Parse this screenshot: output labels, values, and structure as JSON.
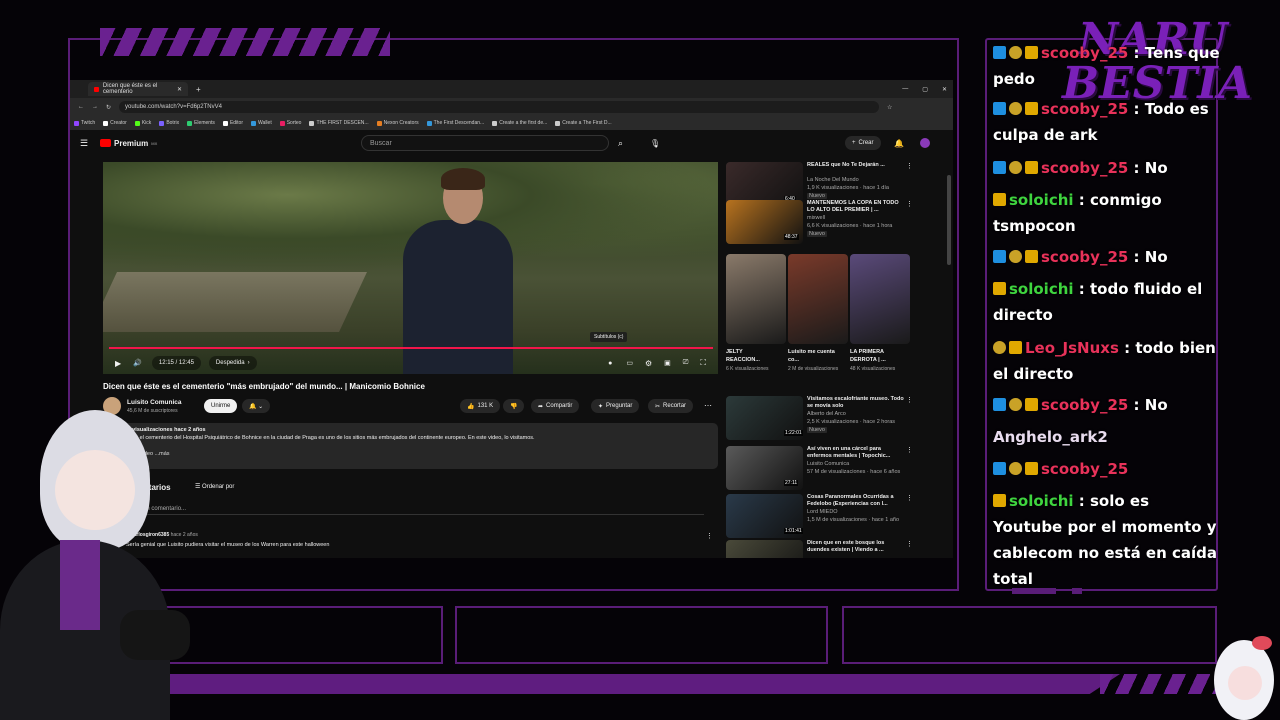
{
  "browser": {
    "tab_title": "Dicen que éste es el cementerio",
    "url": "youtube.com/watch?v=Fd6p2TNvV4",
    "bookmarks": [
      {
        "label": "Twitch",
        "color": "#9146ff"
      },
      {
        "label": "Creator",
        "color": "#ffffff"
      },
      {
        "label": "Kick",
        "color": "#53fc18"
      },
      {
        "label": "Botrix",
        "color": "#7b61ff"
      },
      {
        "label": "Elements",
        "color": "#2ecc71"
      },
      {
        "label": "Editor",
        "color": "#ffffff"
      },
      {
        "label": "Wallet",
        "color": "#3498db"
      },
      {
        "label": "Sorteo",
        "color": "#e91e63"
      },
      {
        "label": "THE FIRST DESCEN...",
        "color": "#cccccc"
      },
      {
        "label": "Nexon Creators",
        "color": "#e67e22"
      },
      {
        "label": "The First Descendan...",
        "color": "#3498db"
      },
      {
        "label": "Create a the first de...",
        "color": "#cccccc"
      },
      {
        "label": "Create a The First D...",
        "color": "#cccccc"
      }
    ]
  },
  "youtube": {
    "brand": "Premium",
    "brand_sup": "MX",
    "search_placeholder": "Buscar",
    "create_label": "Crear",
    "time": "12:15 / 12:45",
    "chapter": "Despedida",
    "tooltip": "Subtítulos (c)",
    "video_title": "Dicen que éste es el cementerio \"más embrujado\" del mundo... | Manicomio Bohnice",
    "channel": "Luisito Comunica",
    "subscribers": "45,6 M de suscriptores",
    "join_label": "Unirme",
    "likes": "131 K",
    "share_label": "Compartir",
    "ask_label": "Preguntar",
    "clip_label": "Recortar",
    "views_line": "7,2 M de visualizaciones  hace 2 años",
    "description": "Se dice que el cementerio del Hospital Psiquiátrico de Bohnice en la ciudad de Praga es uno de los sitios más embrujados del continente europeo. En este video, lo visitamos.",
    "desc_more": "Partes en el video  ...más",
    "comments_count": "2576 comentarios",
    "sort_label": "Ordenar por",
    "add_comment": "Añade un comentario...",
    "comment_user": "@carlosgiron6385",
    "comment_time": "hace 2 años",
    "comment_text": "Sería genial que Luisito pudiera visitar el museo de los Warren para este halloween"
  },
  "recommendations": [
    {
      "title": "REALES que No Te Dejarán ...",
      "channel": "La Noche Del Mundo",
      "stats": "1,9 K visualizaciones · hace 1 día",
      "badge": "Nuevo",
      "duration": "6:40",
      "color": "#3a2a2a"
    },
    {
      "title": "MANTENEMOS LA COPA EN TODO LO ALTO DEL PREMIER | ...",
      "channel": "mixwell",
      "stats": "6,6 K visualizaciones · hace 1 hora",
      "badge": "Nuevo",
      "duration": "48:37",
      "color": "#b8731f"
    },
    {
      "title": "Visitamos escalofriante museo. Todo se movía solo",
      "channel": "Alberto del Arco",
      "stats": "2,5 K visualizaciones · hace 2 horas",
      "badge": "Nuevo",
      "duration": "1:22:01",
      "color": "#2c3a3a"
    },
    {
      "title": "Así viven en una cárcel para enfermos mentales | Topochic...",
      "channel": "Luisito Comunica",
      "stats": "57 M de visualizaciones · hace 6 años",
      "badge": "",
      "duration": "27:11",
      "color": "#5a5a5a"
    },
    {
      "title": "Cosas Paranormales Ocurridas a Fedelobo (Experiencias con l...",
      "channel": "Lord MIEDO",
      "stats": "1,5 M de visualizaciones · hace 1 año",
      "badge": "",
      "duration": "1:01:41",
      "color": "#2a3a4a"
    },
    {
      "title": "Dicen que en este bosque los duendes existen | Viendo a ...",
      "channel": "",
      "stats": "",
      "badge": "",
      "duration": "",
      "color": "#4a4a3a"
    }
  ],
  "shorts": [
    {
      "title": "JELTY REACCION...",
      "views": "6 K visualizaciones",
      "color": "#8a7a6a"
    },
    {
      "title": "Luisito me cuenta co...",
      "views": "2 M de visualizaciones",
      "color": "#7a3a2a"
    },
    {
      "title": "LA PRIMERA DERROTA | ...",
      "views": "48 K visualizaciones",
      "color": "#5a4a7a"
    }
  ],
  "chat": [
    {
      "badges": [
        "p",
        "s",
        "c"
      ],
      "user": "scooby_25",
      "color": "#e8325a",
      "text": "Tens que pedo"
    },
    {
      "badges": [
        "p",
        "s",
        "c"
      ],
      "user": "scooby_25",
      "color": "#e8325a",
      "text": "Todo es culpa de ark"
    },
    {
      "badges": [
        "p",
        "s",
        "c"
      ],
      "user": "scooby_25",
      "color": "#e8325a",
      "text": "No"
    },
    {
      "badges": [
        "c"
      ],
      "user": "soloichi",
      "color": "#3fd43f",
      "text": "conmigo tsmpocon"
    },
    {
      "badges": [
        "p",
        "s",
        "c"
      ],
      "user": "scooby_25",
      "color": "#e8325a",
      "text": "No"
    },
    {
      "badges": [
        "c"
      ],
      "user": "soloichi",
      "color": "#3fd43f",
      "text": "todo fluido el directo"
    },
    {
      "badges": [
        "s",
        "c"
      ],
      "user": "Leo_JsNuxs",
      "color": "#e8325a",
      "text": "todo bien el directo"
    },
    {
      "badges": [
        "p",
        "s",
        "c"
      ],
      "user": "scooby_25",
      "color": "#e8325a",
      "text": "No"
    },
    {
      "badges": [],
      "user": "Anghelo_ark2",
      "color": "#e9dcef",
      "text": ""
    },
    {
      "badges": [
        "p",
        "s",
        "c"
      ],
      "user": "scooby_25",
      "color": "#e8325a",
      "text": ""
    },
    {
      "badges": [
        "c"
      ],
      "user": "soloichi",
      "color": "#3fd43f",
      "text": "solo es Youtube por el momento y cablecom no está en caída total"
    }
  ],
  "overlay": {
    "logo_line1": "NARU",
    "logo_line2": "BESTIA",
    "accent": "#6a2190"
  }
}
